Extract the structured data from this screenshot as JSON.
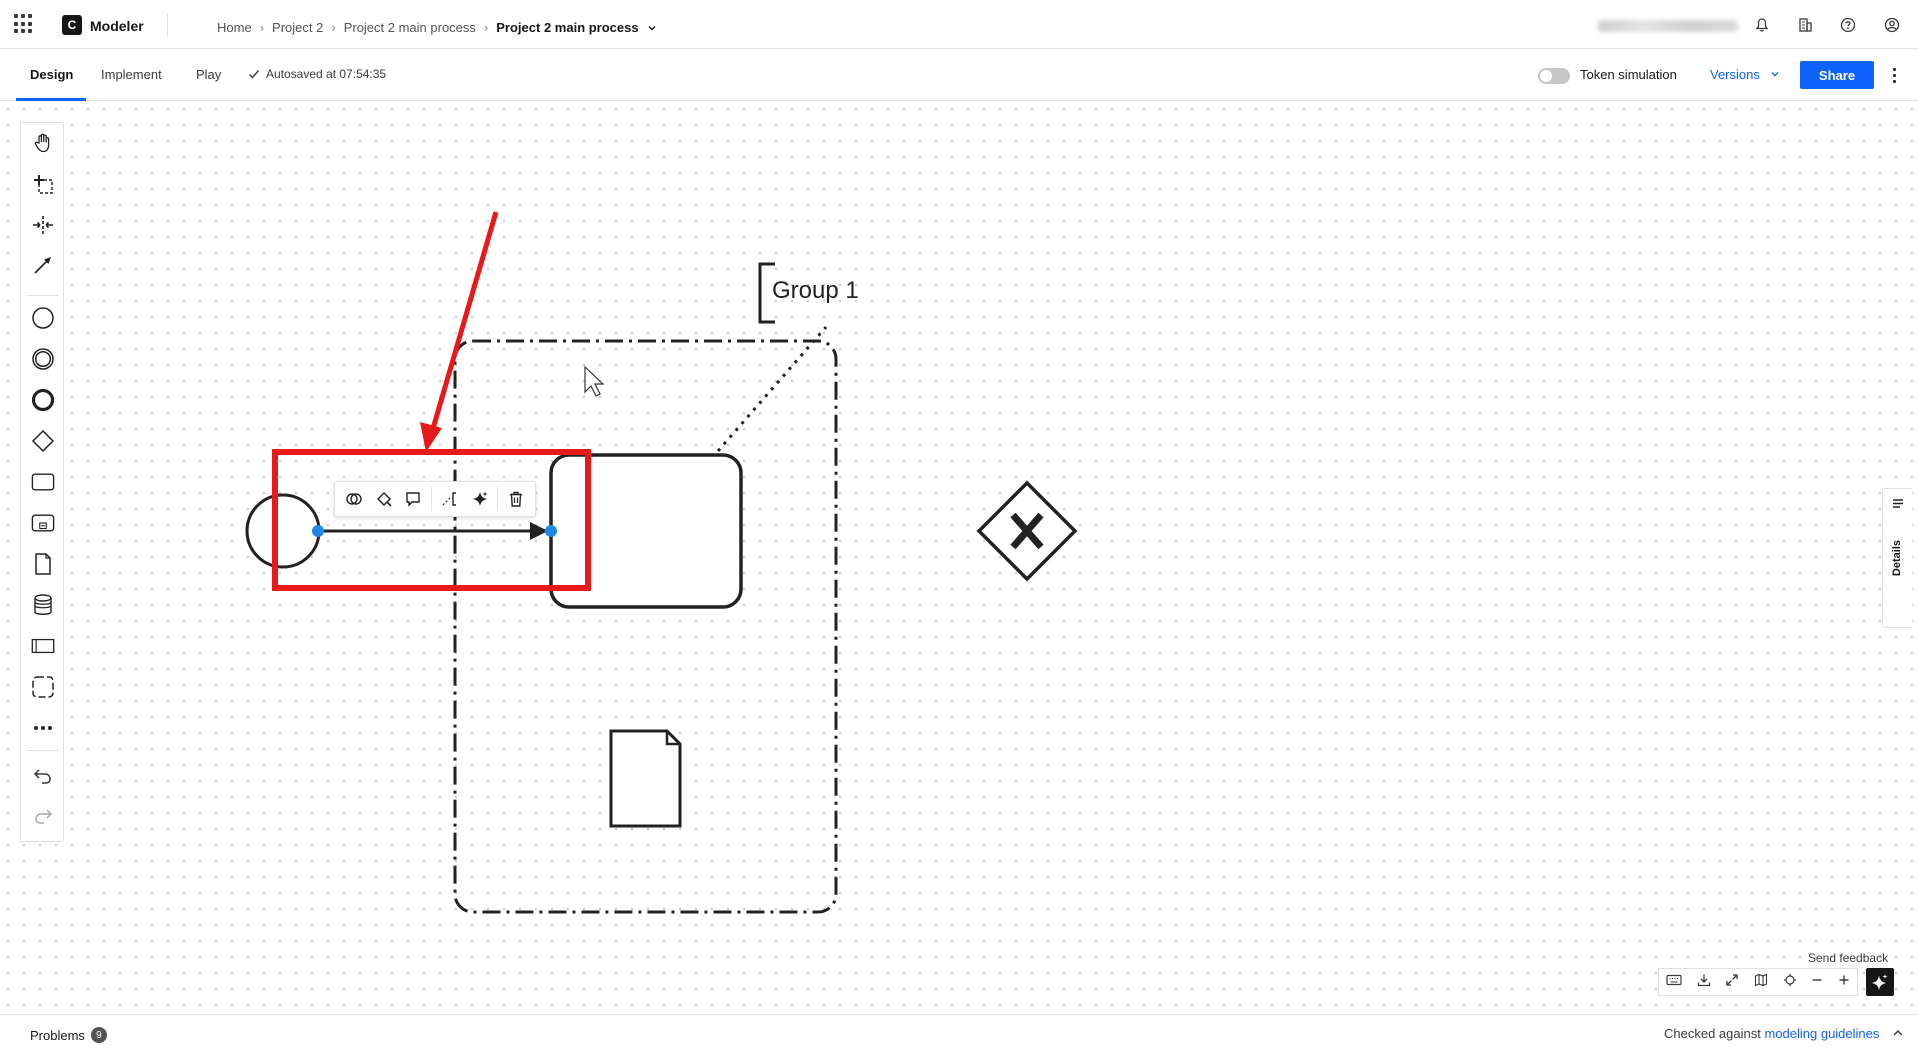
{
  "header": {
    "app_name": "Modeler",
    "logo_letter": "C",
    "breadcrumb": [
      "Home",
      "Project 2",
      "Project 2 main process"
    ],
    "current_file": "Project 2 main process",
    "user_name_redacted": "······ ······· ·····..."
  },
  "subbar": {
    "tabs": [
      {
        "label": "Design",
        "active": true
      },
      {
        "label": "Implement",
        "active": false
      },
      {
        "label": "Play",
        "active": false
      }
    ],
    "autosave": "Autosaved at 07:54:35",
    "token_simulation": "Token simulation",
    "versions": "Versions",
    "share": "Share"
  },
  "palette": [
    "hand-tool-icon",
    "lasso-tool-icon",
    "space-tool-icon",
    "global-connect-icon",
    "start-event-icon",
    "intermediate-event-icon",
    "end-event-icon",
    "gateway-icon",
    "task-icon",
    "subprocess-icon",
    "data-object-icon",
    "data-store-icon",
    "pool-icon",
    "group-icon",
    "more-icon",
    "undo-icon",
    "redo-icon"
  ],
  "canvas": {
    "group_label": "Group 1"
  },
  "details_tab": "Details",
  "footer": {
    "send_feedback": "Send feedback",
    "problems": "Problems",
    "problems_count": "9",
    "checked_prefix": "Checked against",
    "guidelines_link": "modeling guidelines"
  },
  "colors": {
    "accent": "#0f62fe",
    "annotation": "#e8191b",
    "selection": "#1e88e5"
  }
}
